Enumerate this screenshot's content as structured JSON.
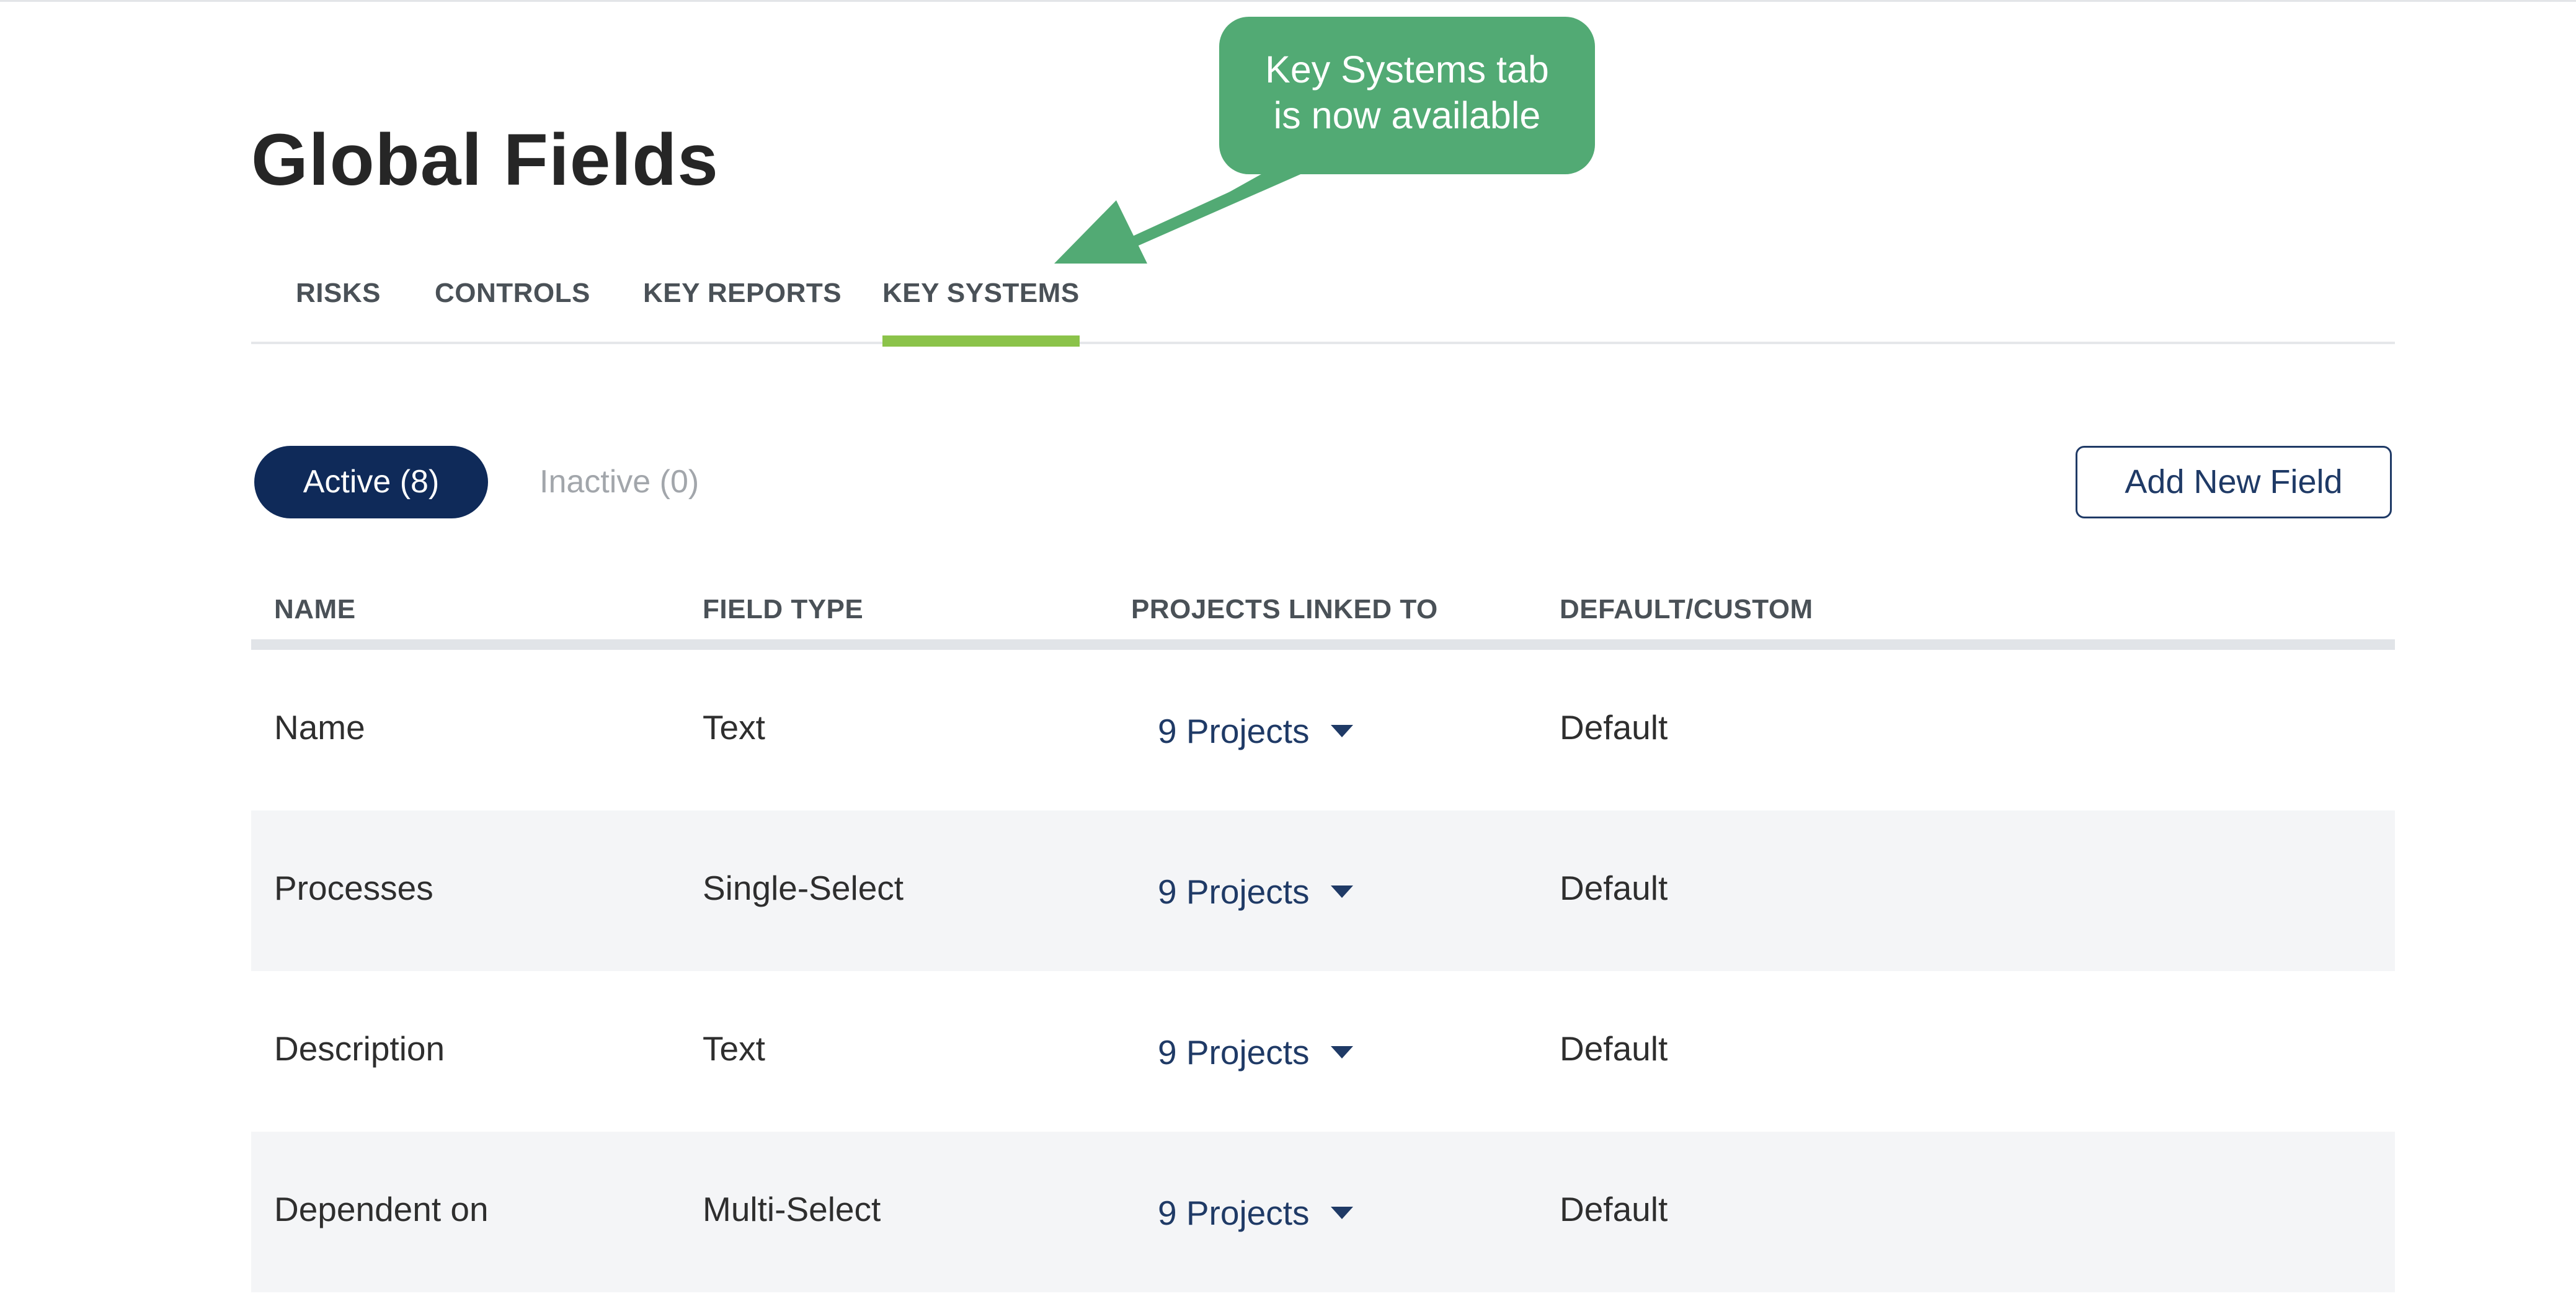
{
  "page": {
    "title": "Global Fields"
  },
  "tabs": [
    {
      "label": "RISKS",
      "active": false
    },
    {
      "label": "CONTROLS",
      "active": false
    },
    {
      "label": "KEY REPORTS",
      "active": false
    },
    {
      "label": "KEY SYSTEMS",
      "active": true
    }
  ],
  "callout": {
    "line1": "Key Systems tab",
    "line2": "is now available",
    "color": "#52aa74"
  },
  "filters": {
    "active_label": "Active (8)",
    "inactive_label": "Inactive (0)"
  },
  "toolbar": {
    "add_label": "Add New Field"
  },
  "table": {
    "columns": [
      "NAME",
      "FIELD TYPE",
      "PROJECTS LINKED TO",
      "DEFAULT/CUSTOM"
    ],
    "rows": [
      {
        "name": "Name",
        "type": "Text",
        "projects": "9 Projects",
        "kind": "Default"
      },
      {
        "name": "Processes",
        "type": "Single-Select",
        "projects": "9 Projects",
        "kind": "Default"
      },
      {
        "name": "Description",
        "type": "Text",
        "projects": "9 Projects",
        "kind": "Default"
      },
      {
        "name": "Dependent on",
        "type": "Multi-Select",
        "projects": "9 Projects",
        "kind": "Default"
      }
    ]
  },
  "colors": {
    "primary": "#0f2a59",
    "tab_indicator": "#8bc34a",
    "row_alt": "#f4f5f7"
  },
  "icons": {
    "dropdown": "caret-down-icon",
    "annotation_arrow": "arrow-icon"
  }
}
